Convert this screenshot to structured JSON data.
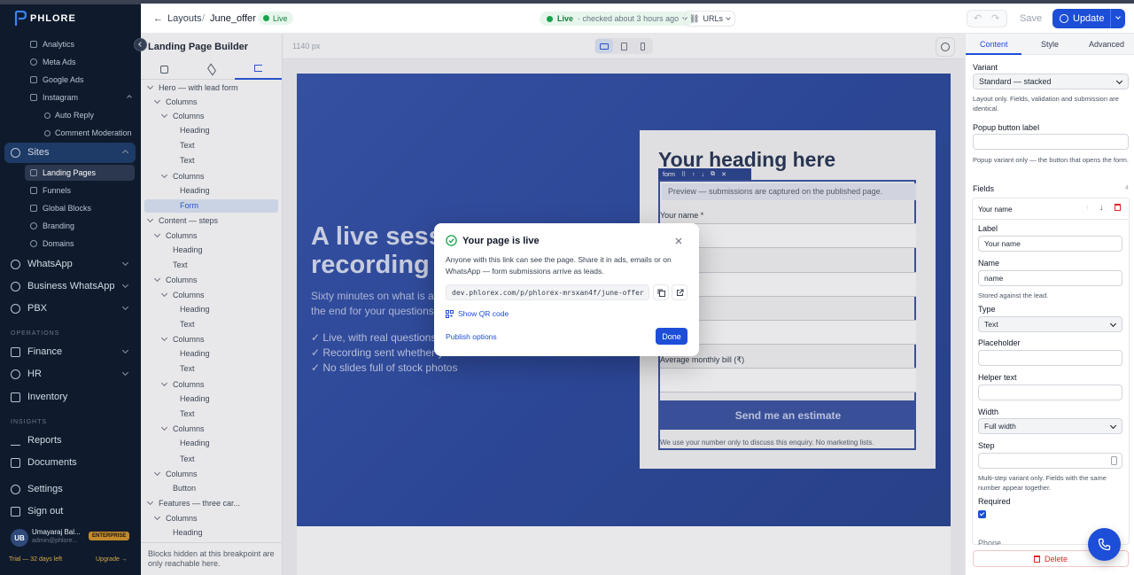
{
  "brand": {
    "name": "PHLORE",
    "accent": "#1d4ed8"
  },
  "sidebar": {
    "marketing_items": [
      {
        "label": "Analytics"
      },
      {
        "label": "Meta Ads"
      },
      {
        "label": "Google Ads"
      },
      {
        "label": "Instagram"
      }
    ],
    "instagram_children": [
      {
        "label": "Auto Reply"
      },
      {
        "label": "Comment Moderation"
      }
    ],
    "sites": {
      "label": "Sites"
    },
    "sites_children": [
      {
        "label": "Landing Pages"
      },
      {
        "label": "Funnels"
      },
      {
        "label": "Global Blocks"
      },
      {
        "label": "Branding"
      },
      {
        "label": "Domains"
      }
    ],
    "whatsapp": "WhatsApp",
    "business_whatsapp": "Business WhatsApp",
    "pbx": "PBX",
    "operations_label": "OPERATIONS",
    "finance": "Finance",
    "hr": "HR",
    "inventory": "Inventory",
    "insights_label": "INSIGHTS",
    "reports": "Reports",
    "documents": "Documents",
    "settings": "Settings",
    "sign_out": "Sign out",
    "user": {
      "initials": "UB",
      "name": "Umayaraj Bal...",
      "email": "admin@phlore...",
      "plan": "ENTERPRISE"
    },
    "trial": "Trial — 32 days left",
    "upgrade": "Upgrade →"
  },
  "topbar": {
    "back_label": "Layouts",
    "separator": "/",
    "page_name": "June_offer",
    "live_badge": "Live",
    "status_live": "Live",
    "status_checked": "· checked about 3 hours ago",
    "urls_label": "URLs",
    "save_label": "Save",
    "update_label": "Update"
  },
  "left_panel": {
    "title": "Landing Page Builder",
    "tree": [
      {
        "label": "Hero — with lead form"
      },
      {
        "label": "Columns"
      },
      {
        "label": "Columns"
      },
      {
        "label": "Heading"
      },
      {
        "label": "Text"
      },
      {
        "label": "Text"
      },
      {
        "label": "Columns"
      },
      {
        "label": "Heading"
      },
      {
        "label": "Form"
      },
      {
        "label": "Content — steps"
      },
      {
        "label": "Columns"
      },
      {
        "label": "Heading"
      },
      {
        "label": "Text"
      },
      {
        "label": "Columns"
      },
      {
        "label": "Columns"
      },
      {
        "label": "Heading"
      },
      {
        "label": "Text"
      },
      {
        "label": "Columns"
      },
      {
        "label": "Heading"
      },
      {
        "label": "Text"
      },
      {
        "label": "Columns"
      },
      {
        "label": "Heading"
      },
      {
        "label": "Text"
      },
      {
        "label": "Columns"
      },
      {
        "label": "Heading"
      },
      {
        "label": "Text"
      },
      {
        "label": "Columns"
      },
      {
        "label": "Button"
      },
      {
        "label": "Features — three car..."
      },
      {
        "label": "Columns"
      },
      {
        "label": "Heading"
      }
    ],
    "footer_note": "Blocks hidden at this breakpoint are only reachable here."
  },
  "canvas": {
    "width_label": "1140 px",
    "hero_heading": "A live session recording a",
    "hero_heading_line1": "A live sessi",
    "hero_heading_line2": "recording a",
    "hero_sub_line1": "Sixty minutes on what is act",
    "hero_sub_line2": "the end for your questions.",
    "bullets": [
      "✓ Live, with real questions a",
      "✓ Recording sent whether yo",
      "✓ No slides full of stock photos"
    ],
    "form_heading": "Your heading here",
    "form_tag": "form",
    "preview_note": "Preview — submissions are captured on the published page.",
    "name_label": "Your name *",
    "bill_label": "Average monthly bill (₹)",
    "submit_label": "Send me an estimate",
    "privacy_note": "We use your number only to discuss this enquiry. No marketing lists."
  },
  "modal": {
    "title": "Your page is live",
    "description": "Anyone with this link can see the page. Share it in ads, emails or on WhatsApp — form submissions arrive as leads.",
    "url": "dev.phlorex.com/p/phlorex-mrsxan4f/june-offer",
    "qr_label": "Show QR code",
    "publish_options": "Publish options",
    "done_label": "Done"
  },
  "right_panel": {
    "tabs": [
      "Content",
      "Style",
      "Advanced"
    ],
    "variant_label": "Variant",
    "variant_value": "Standard — stacked",
    "variant_help": "Layout only. Fields, validation and submission are identical.",
    "popup_label": "Popup button label",
    "popup_help": "Popup variant only — the button that opens the form.",
    "fields_label": "Fields",
    "fields_count": "4",
    "field_name": "Your name",
    "label_label": "Label",
    "label_value": "Your name",
    "name_label": "Name",
    "name_value": "name",
    "name_help": "Stored against the lead.",
    "type_label": "Type",
    "type_value": "Text",
    "placeholder_label": "Placeholder",
    "helper_label": "Helper text",
    "width_label": "Width",
    "width_value": "Full width",
    "step_label": "Step",
    "step_help": "Multi-step variant only. Fields with the same number appear together.",
    "required_label": "Required",
    "phone_label": "Phone",
    "delete_label": "Delete"
  }
}
